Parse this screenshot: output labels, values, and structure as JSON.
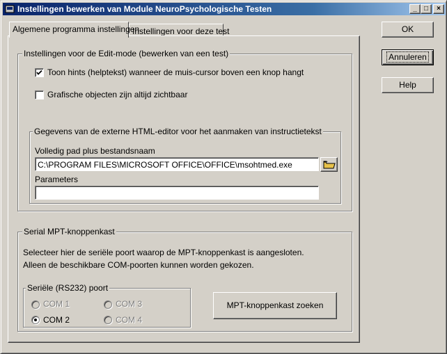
{
  "window": {
    "title": "Instellingen bewerken van Module NeuroPsychologische Testen"
  },
  "titlebar_buttons": {
    "minimize": "_",
    "maximize": "□",
    "close": "×"
  },
  "tabs": [
    {
      "label": "Algemene programma instellingen"
    },
    {
      "label": "Instellingen voor deze test"
    }
  ],
  "edit_mode": {
    "legend": "Instellingen voor de Edit-mode (bewerken van een test)",
    "show_hints": {
      "label": "Toon hints (helptekst) wanneer de muis-cursor boven een knop hangt",
      "checked": true
    },
    "graphic_objects": {
      "label": "Grafische objecten zijn altijd zichtbaar",
      "checked": false
    }
  },
  "html_editor": {
    "legend": "Gegevens van de externe HTML-editor voor het aanmaken van instructietekst",
    "path_label": "Volledig pad plus bestandsnaam",
    "path_value": "C:\\PROGRAM FILES\\MICROSOFT OFFICE\\OFFICE\\msohtmed.exe",
    "params_label": "Parameters",
    "params_value": ""
  },
  "serial": {
    "legend": "Serial MPT-knoppenkast",
    "line1": "Selecteer hier de seriële poort waarop de MPT-knoppenkast is aangesloten.",
    "line2": "Alleen de beschikbare COM-poorten kunnen worden gekozen.",
    "port_legend": "Seriële (RS232) poort",
    "ports": [
      {
        "label": "COM 1",
        "enabled": false,
        "selected": false
      },
      {
        "label": "COM 3",
        "enabled": false,
        "selected": false
      },
      {
        "label": "COM 2",
        "enabled": true,
        "selected": true
      },
      {
        "label": "COM 4",
        "enabled": false,
        "selected": false
      }
    ],
    "search_button": "MPT-knoppenkast zoeken"
  },
  "buttons": {
    "ok": "OK",
    "cancel": "Annuleren",
    "help": "Help"
  },
  "colors": {
    "face": "#d4d0c8",
    "title_start": "#0a246a",
    "title_end": "#a6caf0",
    "folder": "#e8c24a"
  }
}
